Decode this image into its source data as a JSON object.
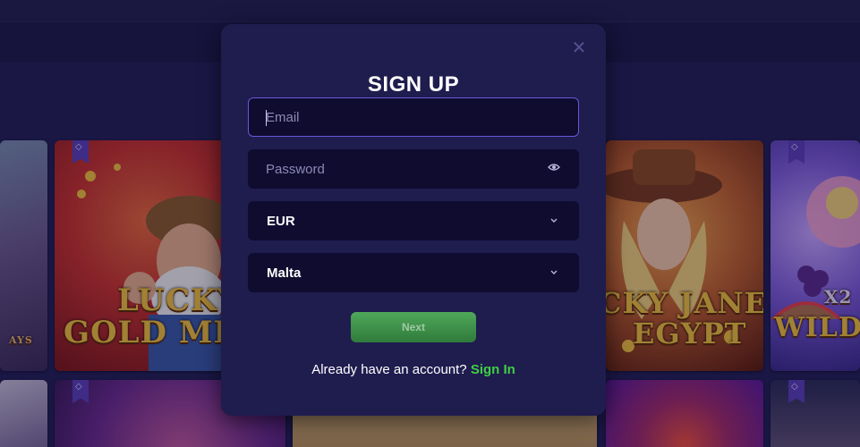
{
  "background": {
    "tiles": [
      {
        "id": "tile-left-partial",
        "title_lines": [
          "",
          "AYS"
        ],
        "colors": [
          "#6b5a8c",
          "#e8b570"
        ]
      },
      {
        "id": "lucky-gold-miner",
        "title_lines": [
          "LUCKY",
          "GOLD MI"
        ],
        "colors": [
          "#c8302a",
          "#f2a62b"
        ]
      },
      {
        "id": "lucky-jane-egypt",
        "title_lines": [
          "CKY JANE",
          "EGYPT"
        ],
        "colors": [
          "#9a3a17",
          "#e8b534"
        ]
      },
      {
        "id": "wild-fruit",
        "title_lines": [
          "X2",
          "WILD F"
        ],
        "colors": [
          "#5b3fb5",
          "#c9a7ff"
        ]
      },
      {
        "id": "bottom-tile-1",
        "title_lines": [
          "",
          ""
        ],
        "colors": [
          "#6a2a8c",
          "#c45a9a"
        ]
      },
      {
        "id": "bottom-tile-2",
        "title_lines": [
          "",
          ""
        ],
        "colors": [
          "#b08a4f",
          "#e8c58a"
        ]
      },
      {
        "id": "bottom-tile-3",
        "title_lines": [
          "",
          ""
        ],
        "colors": [
          "#5a1a9c",
          "#f0503a"
        ]
      },
      {
        "id": "bottom-tile-4",
        "title_lines": [
          "",
          ""
        ],
        "colors": [
          "#2a2a55",
          "#6a5a7a"
        ]
      },
      {
        "id": "bottom-tile-5",
        "title_lines": [
          "",
          ""
        ],
        "colors": [
          "#6b5a8c",
          "#c8c0d8"
        ]
      }
    ]
  },
  "modal": {
    "close_icon": "close-icon",
    "title": "SIGN UP",
    "email": {
      "placeholder": "Email",
      "value": ""
    },
    "password": {
      "placeholder": "Password",
      "value": "",
      "icon": "eye-icon"
    },
    "currency": {
      "selected": "EUR",
      "icon": "chevron-down-icon"
    },
    "country": {
      "selected": "Malta",
      "icon": "chevron-down-icon"
    },
    "next_label": "Next",
    "signin_prompt": "Already have an account?",
    "signin_link": "Sign In"
  },
  "colors": {
    "modal_bg": "#1f1c4e",
    "input_bg": "#0f0c30",
    "focus_border": "#6b57d9",
    "primary_green": "#3fcf45",
    "button_green": "#4fa85a"
  }
}
